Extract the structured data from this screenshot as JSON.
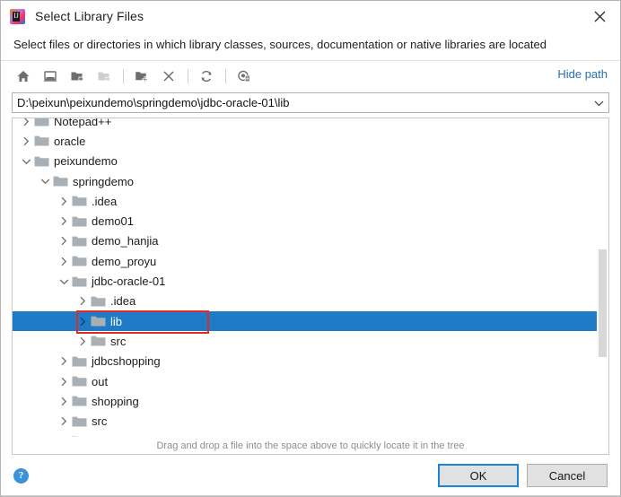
{
  "window": {
    "title": "Select Library Files",
    "app_icon": "intellij-idea-logo",
    "close_label": "×",
    "subtitle": "Select files or directories in which library classes, sources, documentation or native libraries are located"
  },
  "toolbar": {
    "buttons": [
      {
        "name": "home-icon",
        "tooltip": "Home",
        "enabled": true
      },
      {
        "name": "desktop-icon",
        "tooltip": "Desktop",
        "enabled": true
      },
      {
        "name": "folder-up-icon",
        "tooltip": "Up",
        "enabled": true
      },
      {
        "name": "folder-refresh-disabled-icon",
        "tooltip": "Back",
        "enabled": false
      },
      {
        "name": "new-folder-icon",
        "tooltip": "New Folder",
        "enabled": true
      },
      {
        "name": "delete-icon",
        "tooltip": "Delete",
        "enabled": true
      },
      {
        "name": "refresh-icon",
        "tooltip": "Refresh",
        "enabled": true
      },
      {
        "name": "show-hidden-files-icon",
        "tooltip": "Show Hidden Files",
        "enabled": true
      }
    ],
    "hide_path_label": "Hide path"
  },
  "path_field": {
    "value": "D:\\peixun\\peixundemo\\springdemo\\jdbc-oracle-01\\lib",
    "placeholder": "",
    "dropdown_icon": "chevron-down-icon"
  },
  "tree": {
    "rows": [
      {
        "label": "Notepad++",
        "indent": 1,
        "twisty": "collapsed",
        "selected": false,
        "partial_top": true
      },
      {
        "label": "oracle",
        "indent": 1,
        "twisty": "collapsed",
        "selected": false
      },
      {
        "label": "peixundemo",
        "indent": 1,
        "twisty": "expanded",
        "selected": false
      },
      {
        "label": "springdemo",
        "indent": 2,
        "twisty": "expanded",
        "selected": false
      },
      {
        "label": ".idea",
        "indent": 3,
        "twisty": "collapsed",
        "selected": false
      },
      {
        "label": "demo01",
        "indent": 3,
        "twisty": "collapsed",
        "selected": false
      },
      {
        "label": "demo_hanjia",
        "indent": 3,
        "twisty": "collapsed",
        "selected": false
      },
      {
        "label": "demo_proyu",
        "indent": 3,
        "twisty": "collapsed",
        "selected": false
      },
      {
        "label": "jdbc-oracle-01",
        "indent": 3,
        "twisty": "expanded",
        "selected": false
      },
      {
        "label": ".idea",
        "indent": 4,
        "twisty": "collapsed",
        "selected": false
      },
      {
        "label": "lib",
        "indent": 4,
        "twisty": "collapsed",
        "selected": true
      },
      {
        "label": "src",
        "indent": 4,
        "twisty": "collapsed",
        "selected": false
      },
      {
        "label": "jdbcshopping",
        "indent": 3,
        "twisty": "collapsed",
        "selected": false
      },
      {
        "label": "out",
        "indent": 3,
        "twisty": "collapsed",
        "selected": false
      },
      {
        "label": "shopping",
        "indent": 3,
        "twisty": "collapsed",
        "selected": false
      },
      {
        "label": "src",
        "indent": 3,
        "twisty": "collapsed",
        "selected": false
      },
      {
        "label": "Test",
        "indent": 3,
        "twisty": "collapsed",
        "selected": false
      }
    ],
    "scrollbar": {
      "thumb_top_pct": 41,
      "thumb_height_pct": 34
    }
  },
  "annotation": {
    "type": "red-rectangle",
    "target": "lib"
  },
  "hint": {
    "text": "Drag and drop a file into the space above to quickly locate it in the tree"
  },
  "footer": {
    "help_icon": "help-icon",
    "help_glyph": "?",
    "ok_label": "OK",
    "cancel_label": "Cancel"
  },
  "colors": {
    "selection_blue": "#1f7bc8",
    "link_blue": "#2470b3",
    "annotation_red": "#e02b22",
    "folder_gray": "#a9b0b5"
  }
}
